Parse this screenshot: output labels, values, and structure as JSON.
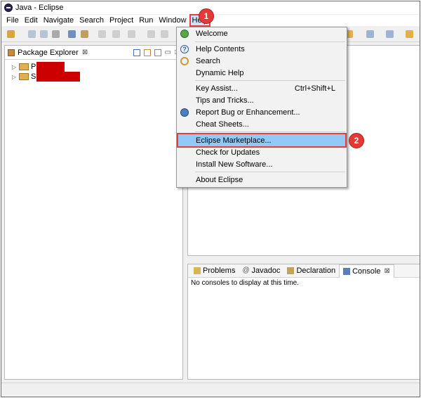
{
  "window": {
    "title": "Java - Eclipse"
  },
  "menubar": {
    "items": [
      "File",
      "Edit",
      "Navigate",
      "Search",
      "Project",
      "Run",
      "Window",
      "Help"
    ],
    "active": "Help"
  },
  "package_explorer": {
    "tab_label": "Package Explorer",
    "close_glyph": "⊠",
    "projects": [
      {
        "label": "P"
      },
      {
        "label": "S"
      }
    ]
  },
  "help_menu": {
    "items": [
      {
        "label": "Welcome",
        "icon": "globe-icon"
      },
      {
        "label": "Help Contents",
        "icon": "question-icon"
      },
      {
        "label": "Search",
        "icon": "search-icon"
      },
      {
        "label": "Dynamic Help",
        "icon": ""
      },
      {
        "label": "Key Assist...",
        "shortcut": "Ctrl+Shift+L",
        "icon": ""
      },
      {
        "label": "Tips and Tricks...",
        "icon": ""
      },
      {
        "label": "Report Bug or Enhancement...",
        "icon": "bug-icon"
      },
      {
        "label": "Cheat Sheets...",
        "icon": ""
      },
      {
        "label": "Eclipse Marketplace...",
        "icon": ""
      },
      {
        "label": "Check for Updates",
        "icon": ""
      },
      {
        "label": "Install New Software...",
        "icon": ""
      },
      {
        "label": "About Eclipse",
        "icon": ""
      }
    ]
  },
  "console_panel": {
    "tabs": [
      "Problems",
      "Javadoc",
      "Declaration",
      "Console"
    ],
    "active_tab": "Console",
    "message": "No consoles to display at this time."
  },
  "callouts": {
    "step1": "1",
    "step2": "2"
  },
  "colors": {
    "highlight_border": "#e24040",
    "selected_item_bg": "#91c9f7",
    "callout_fill": "#e53935",
    "redaction": "#cc0000"
  }
}
